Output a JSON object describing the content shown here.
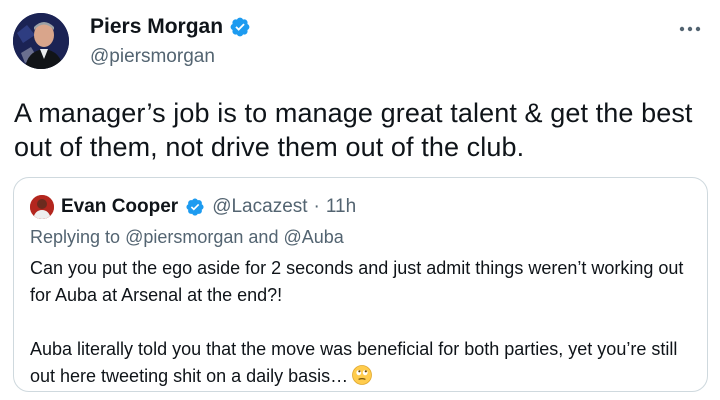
{
  "author": {
    "name": "Piers Morgan",
    "handle": "@piersmorgan",
    "verified_icon": "verified-badge-icon",
    "avatar_icon": "avatar-photo"
  },
  "menu": {
    "more_label": "···",
    "icon": "more-horizontal-icon"
  },
  "tweet": {
    "text": "A manager’s job is to manage great talent & get the best out of them, not drive them out of the club."
  },
  "quote": {
    "author_name": "Evan Cooper",
    "handle": "@Lacazest",
    "separator": "·",
    "time": "11h",
    "replying_prefix": "Replying to",
    "replying_mention_1": "@piersmorgan",
    "replying_and": "and",
    "replying_mention_2": "@Auba",
    "paragraph_1": "Can you put the ego aside for 2 seconds and just admit things weren’t working out for Auba at Arsenal at the end?!",
    "paragraph_2": "Auba literally told you that the move was beneficial for both parties, yet you’re still out here tweeting shit on a daily basis…",
    "emoji_icon": "face-with-rolling-eyes-emoji"
  },
  "colors": {
    "text_primary": "#0f1419",
    "text_secondary": "#536471",
    "verified_blue": "#1d9bf0",
    "card_border": "#cfd9de"
  }
}
